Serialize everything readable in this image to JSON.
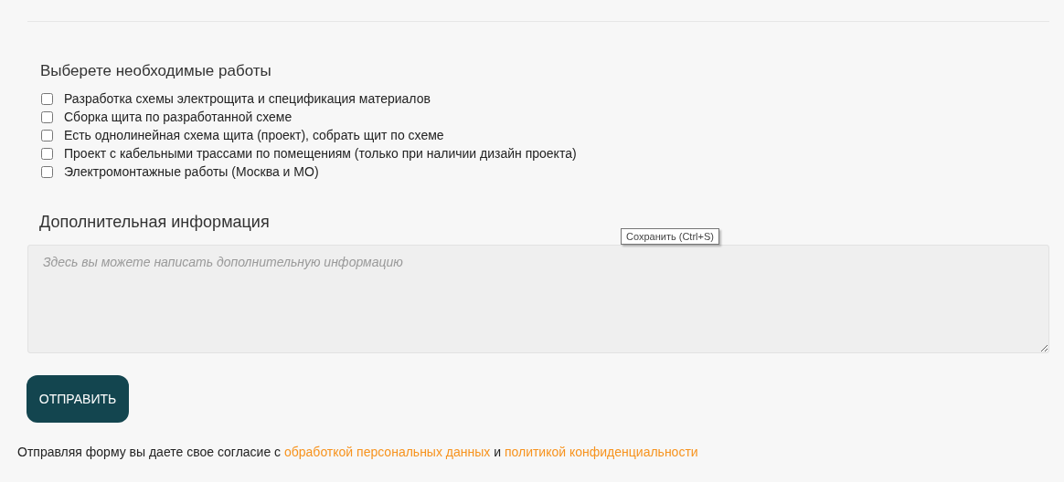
{
  "works": {
    "title": "Выберете необходимые работы",
    "options": [
      {
        "label": "Разработка схемы электрощита и спецификация материалов",
        "checked": false
      },
      {
        "label": "Сборка щита по разработанной схеме",
        "checked": false
      },
      {
        "label": "Есть однолинейная схема щита (проект), собрать щит по схеме",
        "checked": false
      },
      {
        "label": "Проект с кабельными трассами по помещениям (только при наличии дизайн проекта)",
        "checked": false
      },
      {
        "label": "Электромонтажные работы (Москва и МО)",
        "checked": false
      }
    ]
  },
  "additional": {
    "title": "Дополнительная информация",
    "placeholder": "Здесь вы можете написать дополнительную информацию"
  },
  "tooltip": "Сохранить (Ctrl+S)",
  "submit": "ОТПРАВИТЬ",
  "consent": {
    "text": "Отправляя форму вы даете свое согласие с",
    "link_1": "обработкой персональных данных",
    "joiner": "и",
    "link_2": "политикой конфиденциальности"
  }
}
